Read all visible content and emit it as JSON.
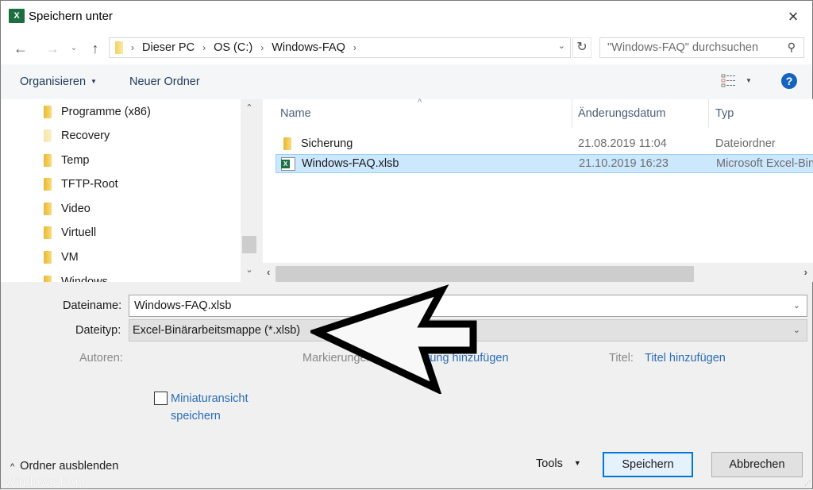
{
  "window": {
    "title": "Speichern unter",
    "app_icon": "excel-icon",
    "close_label": "×"
  },
  "nav": {
    "back_icon": "←",
    "forward_icon": "→",
    "recent_icon": "⌄",
    "up_icon": "↑",
    "breadcrumb": [
      "Dieser PC",
      "OS (C:)",
      "Windows-FAQ"
    ],
    "separator": "›",
    "refresh_icon": "↻",
    "search_placeholder": "\"Windows-FAQ\" durchsuchen",
    "search_icon": "⚲"
  },
  "toolbar": {
    "organize_label": "Organisieren",
    "new_folder_label": "Neuer Ordner",
    "help_label": "?"
  },
  "navpane": {
    "items": [
      {
        "label": "Programme (x86)",
        "faded": false
      },
      {
        "label": "Recovery",
        "faded": true
      },
      {
        "label": "Temp",
        "faded": false
      },
      {
        "label": "TFTP-Root",
        "faded": false
      },
      {
        "label": "Video",
        "faded": false
      },
      {
        "label": "Virtuell",
        "faded": false
      },
      {
        "label": "VM",
        "faded": false
      },
      {
        "label": "Windows",
        "faded": false
      }
    ]
  },
  "filelist": {
    "columns": {
      "name": "Name",
      "date": "Änderungsdatum",
      "type": "Typ"
    },
    "rows": [
      {
        "name": "Sicherung",
        "date": "21.08.2019 11:04",
        "type": "Dateiordner",
        "icon": "folder-icon",
        "selected": false
      },
      {
        "name": "Windows-FAQ.xlsb",
        "date": "21.10.2019 16:23",
        "type": "Microsoft Excel-Binärarbeitsmappe",
        "icon": "excel-file-icon",
        "selected": true
      }
    ]
  },
  "form": {
    "filename_label": "Dateiname:",
    "filename_value": "Windows-FAQ.xlsb",
    "filetype_label": "Dateityp:",
    "filetype_value": "Excel-Binärarbeitsmappe (*.xlsb)",
    "authors_label": "Autoren:",
    "tags_label": "Markierungen:",
    "tags_link": "Markierung hinzufügen",
    "title_label": "Titel:",
    "title_link": "Titel hinzufügen",
    "thumbnail_label_line1": "Miniaturansicht",
    "thumbnail_label_line2": "speichern",
    "thumbnail_checked": false
  },
  "footer": {
    "hide_folders_label": "Ordner ausblenden",
    "tools_label": "Tools",
    "save_label": "Speichern",
    "cancel_label": "Abbrechen",
    "watermark": "Windows-FAQ"
  }
}
